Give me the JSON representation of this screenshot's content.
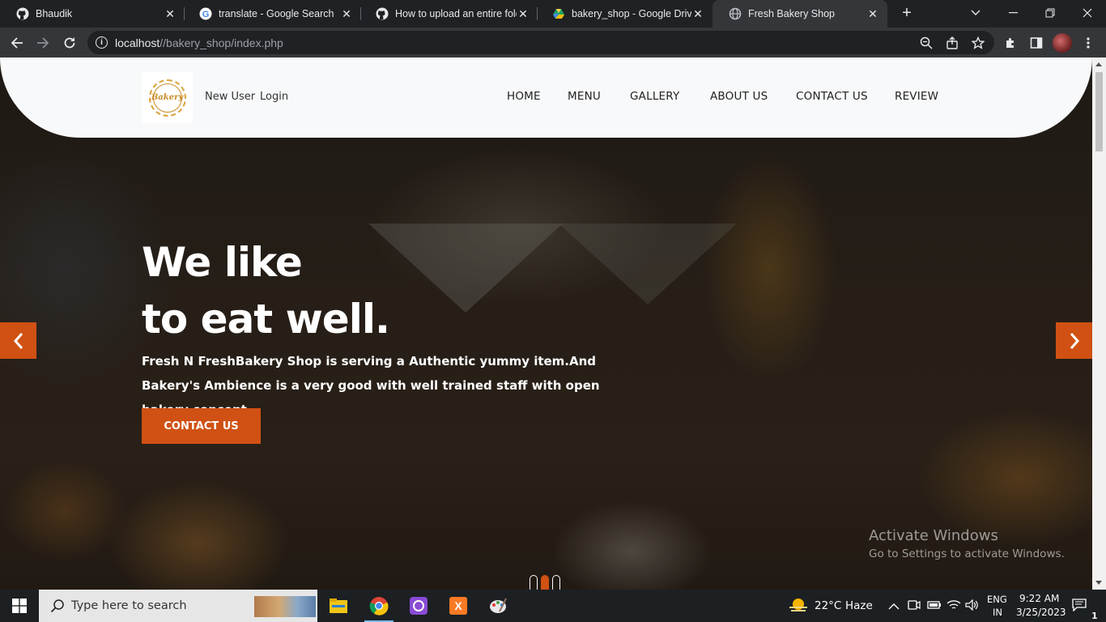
{
  "browser": {
    "tabs": [
      {
        "title": "Bhaudik",
        "icon": "github-icon"
      },
      {
        "title": "translate - Google Search",
        "icon": "google-icon"
      },
      {
        "title": "How to upload an entire fold",
        "icon": "github-icon"
      },
      {
        "title": "bakery_shop - Google Drive",
        "icon": "google-drive-icon"
      },
      {
        "title": "Fresh Bakery Shop",
        "icon": "globe-icon",
        "active": true
      }
    ],
    "url_host": "localhost",
    "url_path": "//bakery_shop/index.php"
  },
  "site": {
    "logo_text": "Bakery",
    "auth": {
      "new_user": "New User",
      "login": "Login"
    },
    "nav": [
      "HOME",
      "MENU",
      "GALLERY",
      "ABOUT US",
      "CONTACT US",
      "REVIEW"
    ],
    "hero": {
      "headline_line1": "We like",
      "headline_line2": "to eat well.",
      "subtext": "Fresh N FreshBakery Shop is serving a Authentic yummy item.And Bakery's Ambience is a very good with well trained staff with open bakery concept...",
      "cta": "CONTACT US",
      "slide_count": 3,
      "active_slide": 2
    },
    "accent_color": "#d05113"
  },
  "os": {
    "watermark_title": "Activate Windows",
    "watermark_sub": "Go to Settings to activate Windows.",
    "search_placeholder": "Type here to search",
    "weather_temp": "22°C",
    "weather_text": "Haze",
    "lang_1": "ENG",
    "lang_2": "IN",
    "time": "9:22 AM",
    "date": "3/25/2023",
    "notification_count": "1"
  }
}
